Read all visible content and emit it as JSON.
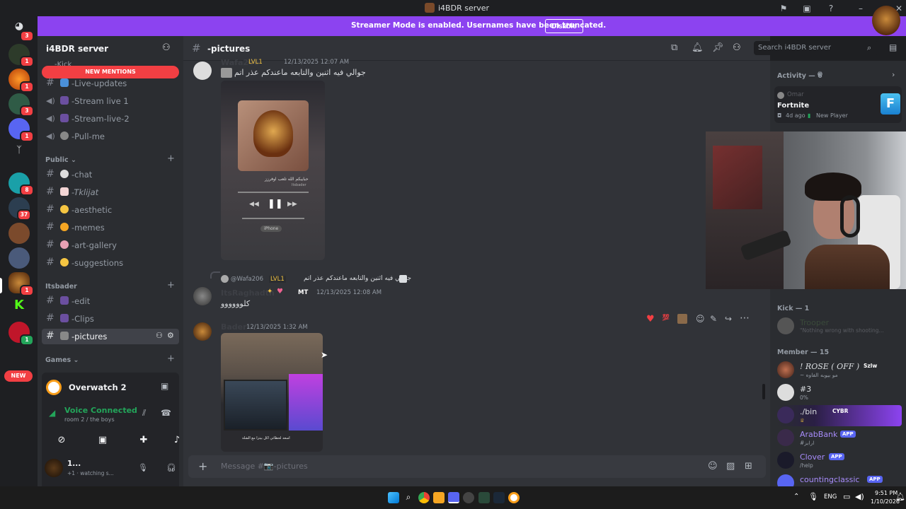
{
  "window": {
    "title": "i4BDR server"
  },
  "banner": {
    "text": "Streamer Mode is enabled. Usernames have been truncated.",
    "button": "Disable"
  },
  "server_rail": {
    "badges": [
      "3",
      "1",
      "1",
      "3",
      "1",
      "8",
      "37",
      "1",
      "1"
    ],
    "new_label": "NEW"
  },
  "sidebar": {
    "server_name": "i4BDR server",
    "new_mentions": "NEW MENTIONS",
    "partial_channel": "-Kick",
    "channels_top": [
      {
        "label": "-Live-updates"
      },
      {
        "label": "-Stream live 1"
      },
      {
        "label": "-Stream-live-2"
      },
      {
        "label": "-Pull-me"
      }
    ],
    "category_public": "Public",
    "channels_public": [
      {
        "label": "-chat"
      },
      {
        "label": "-Tklijat"
      },
      {
        "label": "-aesthetic"
      },
      {
        "label": "-memes"
      },
      {
        "label": "-art-gallery"
      },
      {
        "label": "-suggestions"
      }
    ],
    "category_itsbader": "Itsbader",
    "channels_itsbader": [
      {
        "label": "-edit"
      },
      {
        "label": "-Clips"
      },
      {
        "label": "-pictures"
      }
    ],
    "category_games": "Games",
    "activity_game": "Overwatch 2",
    "voice_status": "Voice Connected",
    "voice_room": "room 2 / the boys",
    "user_name": "1...",
    "user_status": "+1 · watching s..."
  },
  "chat": {
    "channel_name": "-pictures",
    "search_placeholder": "Search i4BDR server",
    "messages": [
      {
        "username": "Wafa206",
        "level": "LVL1",
        "timestamp": "12/13/2025 12:07 AM",
        "text": "جوالي فيه اثنين والتابعه ماعندكم عذر اتم"
      },
      {
        "reply_user": "@Wafa206",
        "reply_level": "LVL1",
        "reply_text": "جوالي فيه اثنين والتابعه ماعندكم عذر اتم",
        "username": "ItsRaghadtn",
        "tag": "MT",
        "timestamp": "12/13/2025 12:08 AM",
        "text": "كلوووووو"
      },
      {
        "username": "Bader",
        "timestamp": "12/13/2025 1:32 AM"
      }
    ],
    "image1_caption": "حبايبكم الله تلعب اوفرزز",
    "image1_sub": "Itsbader",
    "image1_chip": "iPhone",
    "image2_caption": "اسعد لحظاتي اكل بيتزا مع الشلة",
    "composer_placeholder": "Message #📷-pictures"
  },
  "members": {
    "activity_header": "Activity — 6",
    "activity_user": "Omar",
    "activity_game": "Fortnite",
    "activity_meta": "4d ago",
    "activity_tag": "New Player",
    "kick_header": "Kick — 1",
    "kick_member": {
      "name": "Trooper",
      "sub": "\"Nothing wrong with shooting..."
    },
    "member_header": "Member — 15",
    "list": [
      {
        "name": "! ROSE ( OFF )",
        "tag": "Szlw",
        "sub": "~ مو بيوبه الفاوه"
      },
      {
        "name": "#3",
        "sub": "0%"
      },
      {
        "name": "./bin",
        "tag": "CYBR",
        "sub": ""
      },
      {
        "name": "ArabBank",
        "app": "APP",
        "sub": "#ارابز"
      },
      {
        "name": "Clover",
        "app": "APP",
        "sub": "/help"
      },
      {
        "name": "countingclassic",
        "app": "APP",
        "sub": ""
      }
    ]
  },
  "taskbar": {
    "lang": "ENG",
    "time": "9:51 PM",
    "date": "1/10/2026"
  },
  "colors": {
    "accent": "#8c43f0",
    "danger": "#f23f43",
    "online": "#23a55a",
    "blurple": "#5865f2"
  }
}
